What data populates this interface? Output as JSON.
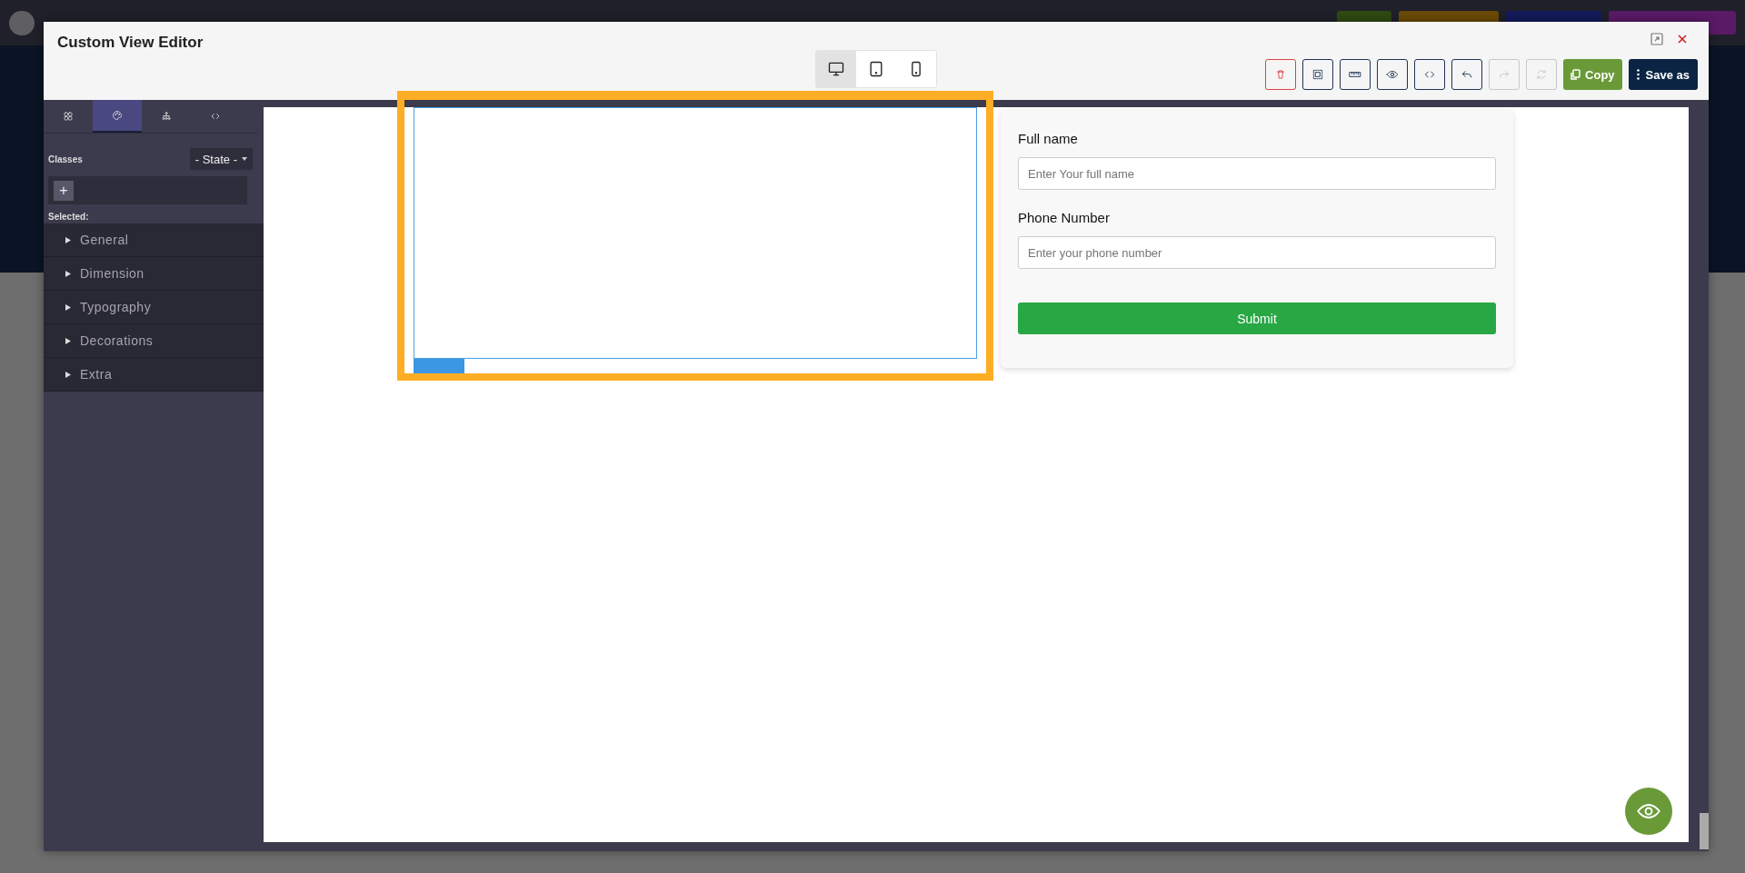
{
  "background": {
    "actions": [
      {
        "color": "#2f4a12"
      },
      {
        "color": "#6b4a06"
      },
      {
        "color": "#141a5a"
      },
      {
        "color": "#5a1a66"
      }
    ]
  },
  "window": {
    "title": "Custom View Editor"
  },
  "devices": [
    {
      "kind": "desktop",
      "selected": true
    },
    {
      "kind": "tablet",
      "selected": false
    },
    {
      "kind": "mobile",
      "selected": false
    }
  ],
  "toolbar": [
    {
      "kind": "delete",
      "disabled": false
    },
    {
      "kind": "outline",
      "disabled": false
    },
    {
      "kind": "ruler",
      "disabled": false
    },
    {
      "kind": "preview",
      "disabled": false
    },
    {
      "kind": "code",
      "disabled": false
    },
    {
      "kind": "undo",
      "disabled": false
    },
    {
      "kind": "redo",
      "disabled": true
    },
    {
      "kind": "refresh",
      "disabled": true
    }
  ],
  "copy_button": "Copy",
  "save_button": "Save as",
  "panel_tabs": [
    {
      "kind": "blocks",
      "selected": false
    },
    {
      "kind": "style",
      "selected": true
    },
    {
      "kind": "layers",
      "selected": false
    },
    {
      "kind": "code",
      "selected": false
    }
  ],
  "classes": {
    "label": "Classes",
    "state": "- State -",
    "add": "+",
    "selected_label": "Selected:"
  },
  "sections": [
    "General",
    "Dimension",
    "Typography",
    "Decorations",
    "Extra"
  ],
  "form": {
    "fields": [
      {
        "label": "Full name",
        "placeholder": "Enter Your full name"
      },
      {
        "label": "Phone Number",
        "placeholder": "Enter your phone number"
      }
    ],
    "submit": "Submit"
  }
}
